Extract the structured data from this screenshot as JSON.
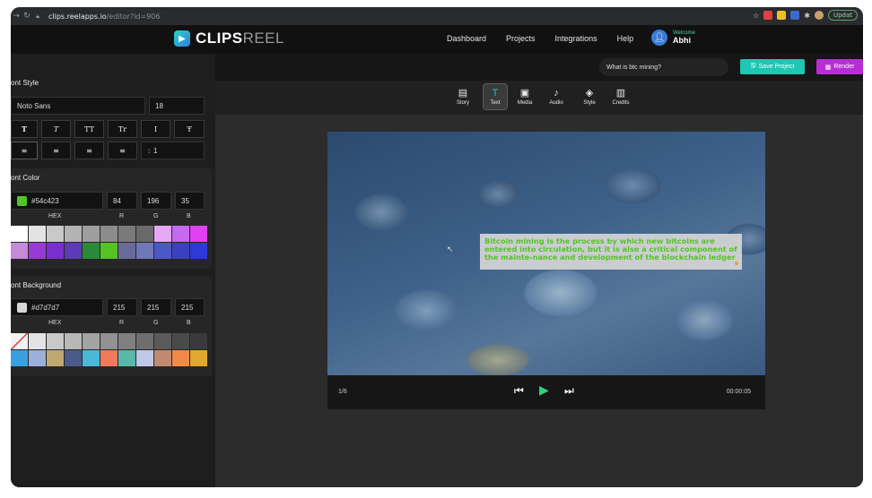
{
  "browser": {
    "url_domain": "clips.reelapps.io",
    "url_path": "/editor?id=906",
    "update_label": "Updat"
  },
  "header": {
    "logo_main": "CLIPS",
    "logo_sub": "REEL",
    "nav": [
      "Dashboard",
      "Projects",
      "Integrations",
      "Help"
    ],
    "welcome": "Welcome",
    "username": "Abhi"
  },
  "font_style": {
    "title": "ont Style",
    "family": "Noto Sans",
    "size": "18",
    "style_buttons": [
      "T",
      "T",
      "TT",
      "Tr",
      "I",
      "Ŧ"
    ],
    "align_buttons": [
      "≡",
      "≡",
      "≡",
      "≡"
    ],
    "line_spacing": "1"
  },
  "font_color": {
    "title": "ont Color",
    "hex": "#54c423",
    "r": "84",
    "g": "196",
    "b": "35",
    "hex_label": "HEX",
    "r_label": "R",
    "g_label": "G",
    "b_label": "B",
    "swatch_color": "#54c423",
    "palette": [
      "#ffffff",
      "#e3e3e3",
      "#c9c9c9",
      "#b3b3b3",
      "#9e9e9e",
      "#8c8c8c",
      "#7a7a7a",
      "#6a6a6a",
      "#e6a7f5",
      "#c46af0",
      "#e040f0",
      "#c58ad8",
      "#9a3ad6",
      "#7a2fd0",
      "#5c3ab8",
      "#2a8a3a",
      "#54c423",
      "#6a6a9a",
      "#7078b8",
      "#4b58c8",
      "#3a40c0",
      "#2d3ad6"
    ]
  },
  "font_background": {
    "title": "ont Background",
    "hex": "#d7d7d7",
    "r": "215",
    "g": "215",
    "b": "215",
    "hex_label": "HEX",
    "r_label": "R",
    "g_label": "G",
    "b_label": "B",
    "swatch_color": "#d7d7d7",
    "palette": [
      "none",
      "#e3e3e3",
      "#c9c9c9",
      "#b8b8b8",
      "#a3a3a3",
      "#929292",
      "#808080",
      "#6e6e6e",
      "#5a5a5a",
      "#4a4a4a",
      "#3a3a3a",
      "#3a9fe0",
      "#9ab0d8",
      "#c0a870",
      "#4a5a8a",
      "#4ab8d8",
      "#f07a5a",
      "#5ab8a8",
      "#c0c8e8",
      "#c08a70",
      "#f08a4a",
      "#e0a830"
    ]
  },
  "toolbar": {
    "search": "What is btc mining?",
    "save_label": "Save Project",
    "render_label": "Render",
    "tools": [
      {
        "label": "Story",
        "icon": "story-icon",
        "glyph": "▤"
      },
      {
        "label": "Text",
        "icon": "text-icon",
        "glyph": "T"
      },
      {
        "label": "Media",
        "icon": "media-icon",
        "glyph": "▣"
      },
      {
        "label": "Audio",
        "icon": "audio-icon",
        "glyph": "♪"
      },
      {
        "label": "Style",
        "icon": "style-icon",
        "glyph": "◈"
      },
      {
        "label": "Credits",
        "icon": "credits-icon",
        "glyph": "▥"
      }
    ]
  },
  "preview": {
    "caption": "Bitcoin mining is the process by which new bitcoins are entered into circulation, but it is also a critical component of the mainte-nance and development of the blockchain ledger",
    "caption_color": "#54c423",
    "caption_bg": "#d7d7d7",
    "slide_counter": "1/6",
    "time": "00:00:05"
  }
}
